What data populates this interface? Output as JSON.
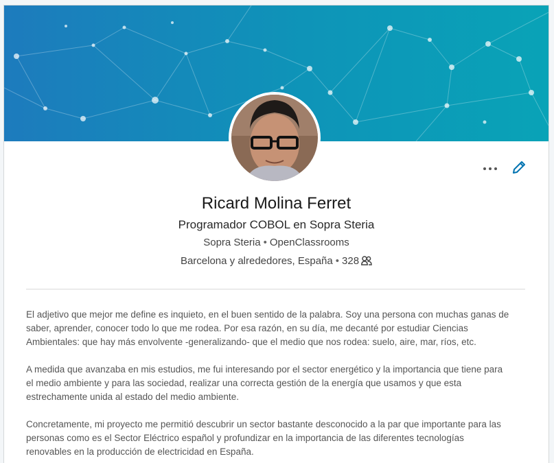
{
  "profile": {
    "name": "Ricard Molina Ferret",
    "headline": "Programador COBOL en Sopra Steria",
    "company": "Sopra Steria",
    "education": "OpenClassrooms",
    "location": "Barcelona y alrededores, España",
    "connections": "328"
  },
  "summary": {
    "paragraphs": [
      "El adjetivo que mejor me define es inquieto, en el buen sentido de la palabra. Soy una persona con muchas ganas de\nsaber, aprender, conocer todo lo que me rodea. Por esa razón, en su día, me decanté por estudiar Ciencias\nAmbientales: que hay más envolvente -generalizando- que el medio que nos rodea: suelo, aire, mar, ríos, etc.",
      "A medida que avanzaba en mis estudios, me fui interesando por el sector energético y la importancia que tiene para\nel medio ambiente y para las sociedad, realizar una correcta gestión de la energía que usamos y que esta\nestrechamente unida al estado del medio ambiente.",
      "Concretamente, mi proyecto me permitió descubrir un sector bastante desconocido a la par que importante para las\npersonas como es el Sector Eléctrico español y profundizar en la importancia de las diferentes tecnologías\nrenovables en la producción de electricidad en España."
    ]
  },
  "icons": {
    "more": "more-horizontal-icon",
    "edit": "pencil-icon",
    "connections": "people-icon"
  },
  "colors": {
    "banner_start": "#1d7bbd",
    "banner_end": "#09a3b7",
    "edit_icon": "#0073b1"
  }
}
